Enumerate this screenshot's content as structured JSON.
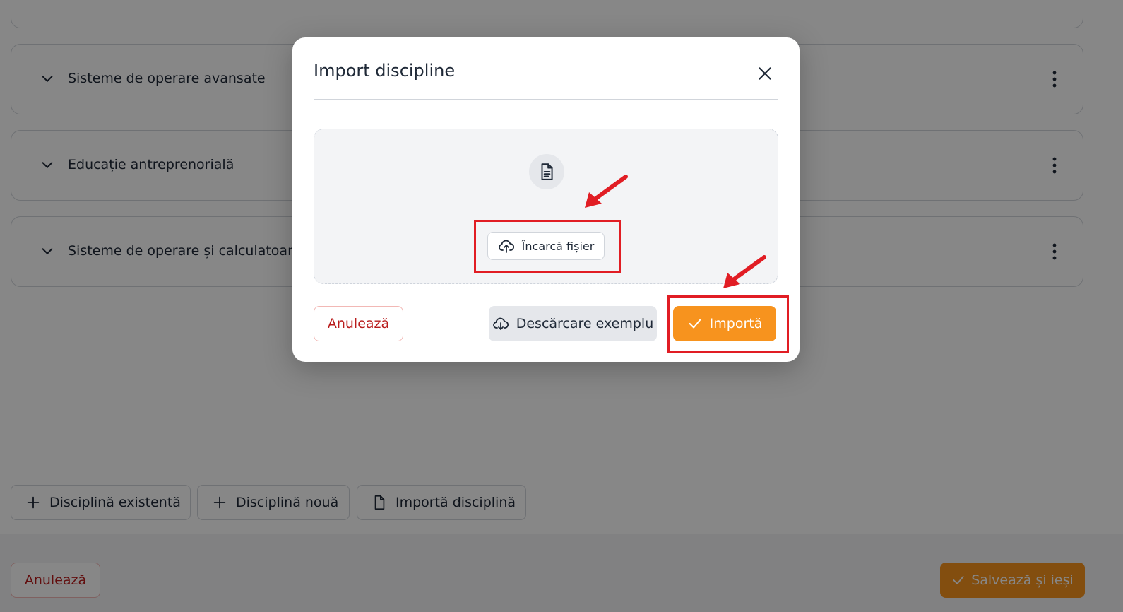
{
  "page": {
    "disciplines": [
      {
        "label": "Sisteme de operare avansate"
      },
      {
        "label": "Educație antreprenorială"
      },
      {
        "label": "Sisteme de operare și calculatoare"
      }
    ],
    "actions": {
      "existing_label": "Disciplină existentă",
      "new_label": "Disciplină nouă",
      "import_label": "Importă disciplină"
    },
    "footer": {
      "cancel_label": "Anulează",
      "save_label": "Salvează și ieși"
    }
  },
  "modal": {
    "title": "Import discipline",
    "upload_label": "Încarcă fișier",
    "cancel_label": "Anulează",
    "download_label": "Descărcare exemplu",
    "import_label": "Importă"
  },
  "colors": {
    "accent_orange": "#f7931e",
    "danger_red": "#b91c1c",
    "annotation_red": "#e11d24"
  },
  "icons": {
    "row_expand": "chevron-down-icon",
    "row_menu": "kebab-menu-icon",
    "close": "close-icon",
    "file": "file-text-icon",
    "upload": "cloud-upload-icon",
    "download": "cloud-download-icon",
    "check": "check-icon",
    "plus": "plus-icon"
  }
}
